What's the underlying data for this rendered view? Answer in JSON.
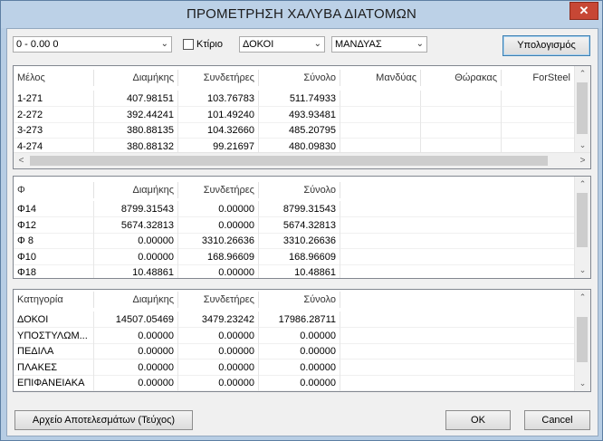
{
  "window": {
    "title": "ΠΡΟΜΕΤΡΗΣΗ ΧΑΛΥΒΑ ΔΙΑΤΟΜΩΝ",
    "close_glyph": "✕"
  },
  "toolbar": {
    "level_select": "0 - 0.00 0",
    "building_label": "Κτίριο",
    "building_checked": false,
    "element_type_select": "ΔΟΚΟΙ",
    "category_select": "ΜΑΝΔΥΑΣ",
    "calculate_label": "Υπολογισμός"
  },
  "members": {
    "headers": [
      "Μέλος",
      "Διαμήκης",
      "Συνδετήρες",
      "Σύνολο",
      "Μανδύας",
      "Θώρακας",
      "ForSteel"
    ],
    "rows": [
      [
        "1-271",
        "407.98151",
        "103.76783",
        "511.74933"
      ],
      [
        "2-272",
        "392.44241",
        "101.49240",
        "493.93481"
      ],
      [
        "3-273",
        "380.88135",
        "104.32660",
        "485.20795"
      ],
      [
        "4-274",
        "380.88132",
        "99.21697",
        "480.09830"
      ]
    ]
  },
  "diameters": {
    "headers": [
      "Φ",
      "Διαμήκης",
      "Συνδετήρες",
      "Σύνολο"
    ],
    "rows": [
      [
        "Φ14",
        "8799.31543",
        "0.00000",
        "8799.31543"
      ],
      [
        "Φ12",
        "5674.32813",
        "0.00000",
        "5674.32813"
      ],
      [
        "Φ 8",
        "0.00000",
        "3310.26636",
        "3310.26636"
      ],
      [
        "Φ10",
        "0.00000",
        "168.96609",
        "168.96609"
      ],
      [
        "Φ18",
        "10.48861",
        "0.00000",
        "10.48861"
      ]
    ]
  },
  "categories": {
    "headers": [
      "Κατηγορία",
      "Διαμήκης",
      "Συνδετήρες",
      "Σύνολο"
    ],
    "rows": [
      [
        "ΔΟΚΟΙ",
        "14507.05469",
        "3479.23242",
        "17986.28711"
      ],
      [
        "ΥΠΟΣΤΥΛΩΜ...",
        "0.00000",
        "0.00000",
        "0.00000"
      ],
      [
        "ΠΕΔΙΛΑ",
        "0.00000",
        "0.00000",
        "0.00000"
      ],
      [
        "ΠΛΑΚΕΣ",
        "0.00000",
        "0.00000",
        "0.00000"
      ],
      [
        "ΕΠΙΦΑΝΕΙΑΚΑ",
        "0.00000",
        "0.00000",
        "0.00000"
      ]
    ]
  },
  "footer": {
    "results_file_label": "Αρχείο Αποτελεσμάτων (Τεύχος)",
    "ok_label": "OK",
    "cancel_label": "Cancel"
  },
  "icons": {
    "dropdown_arrow": "⌄",
    "scroll_up": "⌃",
    "scroll_down": "⌄",
    "scroll_left": "<",
    "scroll_right": ">"
  }
}
